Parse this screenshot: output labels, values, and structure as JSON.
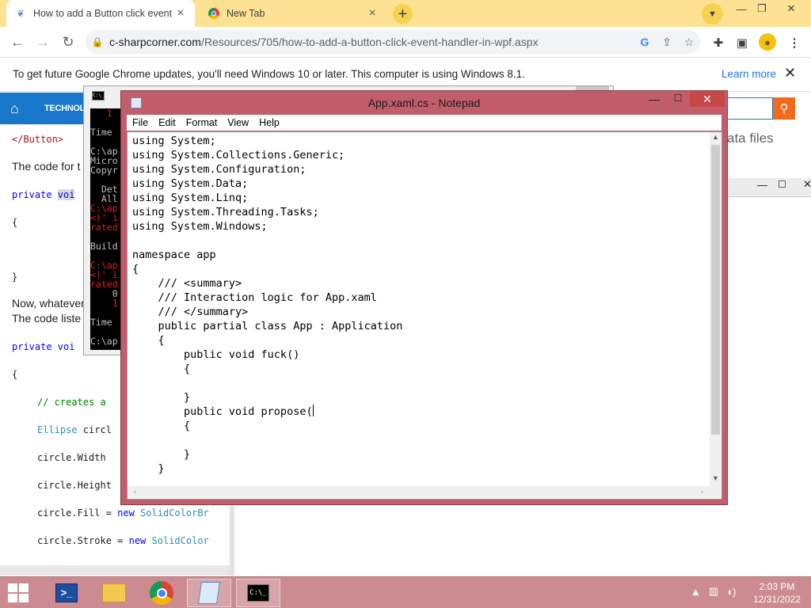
{
  "browser": {
    "tabs": [
      {
        "title": "How to add a Button click event h",
        "favicon": "c-sharpcorner-icon",
        "close": "×"
      },
      {
        "title": "New Tab",
        "favicon": "chrome-icon",
        "close": "×"
      }
    ],
    "new_tab": "+",
    "url_domain": "c-sharpcorner.com",
    "url_path": "/Resources/705/how-to-add-a-button-click-event-handler-in-wpf.aspx",
    "window_controls": {
      "minimize": "—",
      "restore": "❐",
      "close": "✕"
    }
  },
  "infobar": {
    "message": "To get future Google Chrome updates, you'll need Windows 10 or later. This computer is using Windows 8.1.",
    "link": "Learn more",
    "close": "✕"
  },
  "webpage": {
    "nav_label": "TECHNOLOG",
    "right_text": "ata files",
    "lines": {
      "button_close": "</Button>",
      "code_for": "The code for t",
      "private1_a": "private ",
      "private1_b": "voi",
      "brace_open1": "{",
      "brace_close1": "}",
      "now_whatever": "Now, whatever",
      "code_listen": "The code liste",
      "private2_a": "private ",
      "private2_b": "voi",
      "brace_open2": "{",
      "comment": "// creates a",
      "ellipse_a": "Ellipse",
      "ellipse_b": " circl",
      "width": "circle.Width",
      "height": "circle.Height",
      "fill_a": "circle.Fill = ",
      "fill_b": "new",
      "fill_c": "SolidColorBr",
      "stroke_a": "circle.Stroke = ",
      "stroke_b": "new",
      "stroke_c": "SolidColor"
    }
  },
  "console": {
    "icon_text": "C:\\_",
    "lines": [
      {
        "text": "   1",
        "color": "red"
      },
      {
        "text": "",
        "color": "gray"
      },
      {
        "text": "Time",
        "color": "gray"
      },
      {
        "text": "",
        "color": "gray"
      },
      {
        "text": "C:\\ap",
        "color": "gray"
      },
      {
        "text": "Micro",
        "color": "gray"
      },
      {
        "text": "Copyr",
        "color": "gray"
      },
      {
        "text": "",
        "color": "gray"
      },
      {
        "text": "  Det",
        "color": "gray"
      },
      {
        "text": "  All",
        "color": "gray"
      },
      {
        "text": "C:\\ap",
        "color": "red"
      },
      {
        "text": "<)' i",
        "color": "red"
      },
      {
        "text": "rated",
        "color": "red"
      },
      {
        "text": "",
        "color": "gray"
      },
      {
        "text": "Build",
        "color": "gray"
      },
      {
        "text": "",
        "color": "gray"
      },
      {
        "text": "C:\\ap",
        "color": "red"
      },
      {
        "text": "<)' i",
        "color": "red"
      },
      {
        "text": "rated",
        "color": "red"
      },
      {
        "text": "    0",
        "color": "gray"
      },
      {
        "text": "    1",
        "color": "red"
      },
      {
        "text": "",
        "color": "gray"
      },
      {
        "text": "Time",
        "color": "gray"
      },
      {
        "text": "",
        "color": "gray"
      },
      {
        "text": "C:\\ap",
        "color": "gray"
      }
    ]
  },
  "notepad": {
    "title": "App.xaml.cs - Notepad",
    "menu": [
      "File",
      "Edit",
      "Format",
      "View",
      "Help"
    ],
    "lines": [
      "using System;",
      "using System.Collections.Generic;",
      "using System.Configuration;",
      "using System.Data;",
      "using System.Linq;",
      "using System.Threading.Tasks;",
      "using System.Windows;",
      "",
      "namespace app",
      "{",
      "    /// <summary>",
      "    /// Interaction logic for App.xaml",
      "    /// </summary>",
      "    public partial class App : Application",
      "    {",
      "        public void fuck()",
      "        {",
      "",
      "        }",
      "        public void propose(",
      "        {",
      "",
      "        }",
      "    }"
    ],
    "caret_line": 19,
    "window_controls": {
      "minimize": "—",
      "maximize": "☐",
      "close": "✕"
    }
  },
  "taskbar": {
    "apps": [
      {
        "name": "powershell",
        "active": false
      },
      {
        "name": "file-explorer",
        "active": false
      },
      {
        "name": "chrome",
        "active": false
      },
      {
        "name": "notepad",
        "active": true
      },
      {
        "name": "cmd",
        "active": true
      }
    ],
    "cmd_label": "C:\\_",
    "ps_label": ">_",
    "clock_time": "2:03 PM",
    "clock_date": "12/31/2022"
  },
  "colors": {
    "tabstrip": "#fde293",
    "notepad_frame": "#c25d6b",
    "taskbar": "#cc8b91",
    "site_blue": "#1877c8",
    "search_orange": "#f26a1b"
  }
}
